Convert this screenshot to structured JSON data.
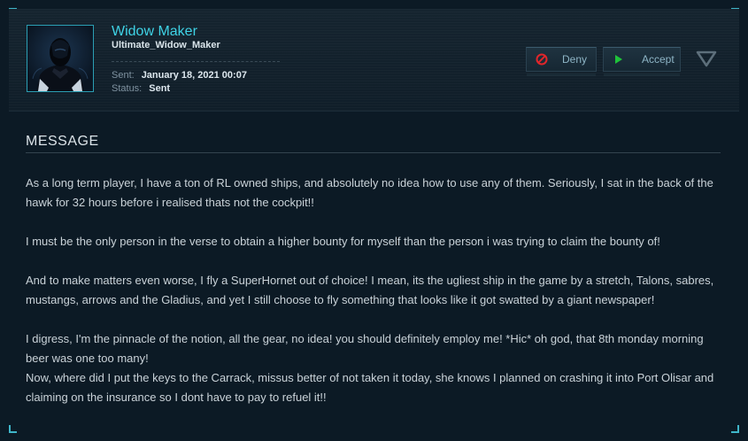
{
  "sender": {
    "display_name": "Widow Maker",
    "handle": "Ultimate_Widow_Maker"
  },
  "meta": {
    "sent_label": "Sent:",
    "sent_value": "January 18, 2021 00:07",
    "status_label": "Status:",
    "status_value": "Sent"
  },
  "actions": {
    "deny_label": "Deny",
    "accept_label": "Accept"
  },
  "section_title": "MESSAGE",
  "message_paragraphs": [
    "As a long term player, I have a ton of RL owned ships, and absolutely no idea how to use any of them. Seriously, I sat in the back of the hawk for 32 hours before i realised thats not the cockpit!!",
    "I must be the only person in the verse to obtain a higher bounty for myself than the person i was trying to claim the bounty of!",
    "And to make matters even worse, I fly a SuperHornet out of choice! I mean, its the ugliest ship in the game by a stretch, Talons, sabres, mustangs, arrows and the Gladius, and yet I still choose to fly something that looks like it got swatted by a giant newspaper!",
    "I digress, I'm the pinnacle of the notion, all the gear, no idea! you should definitely employ me! *Hic* oh god, that 8th monday morning beer was one too many!",
    "Now, where did I put the keys to the Carrack, missus better of not taken it today, she knows I planned on crashing it into Port Olisar and claiming on the insurance so I dont have to pay to refuel it!!"
  ],
  "colors": {
    "accent": "#3fd3e6",
    "deny_icon": "#e0262b",
    "accept_icon": "#1fc23a"
  },
  "icons": {
    "deny": "no-entry-icon",
    "accept": "play-icon",
    "expand": "chevron-down-icon"
  }
}
